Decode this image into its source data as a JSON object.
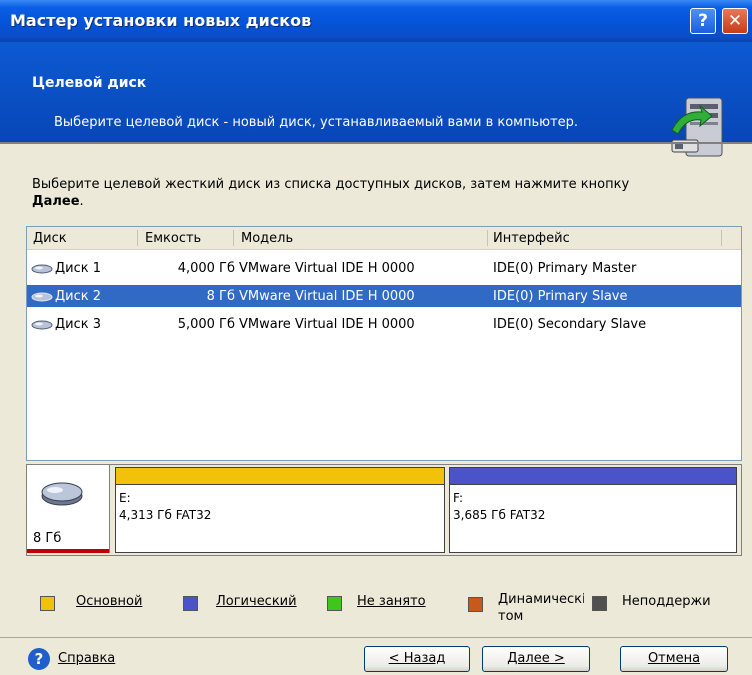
{
  "window": {
    "title": "Мастер установки новых дисков",
    "help_glyph": "?",
    "close_glyph": "✕"
  },
  "header": {
    "title": "Целевой диск",
    "subtitle": "Выберите целевой диск - новый диск, устанавливаемый вами в компьютер."
  },
  "instruction": {
    "text": "Выберите целевой жесткий диск из списка доступных дисков, затем нажмите кнопку",
    "bold": "Далее",
    "suffix": "."
  },
  "table": {
    "columns": [
      "Диск",
      "Емкость",
      "Модель",
      "Интерфейс"
    ],
    "rows": [
      {
        "disk": "Диск 1",
        "capacity": "4,000 Гб",
        "model": "VMware Virtual IDE H 0000",
        "interface": "IDE(0) Primary Master",
        "selected": false
      },
      {
        "disk": "Диск 2",
        "capacity": "8 Гб",
        "model": "VMware Virtual IDE H 0000",
        "interface": "IDE(0) Primary Slave",
        "selected": true
      },
      {
        "disk": "Диск 3",
        "capacity": "5,000 Гб",
        "model": "VMware Virtual IDE H 0000",
        "interface": "IDE(0) Secondary Slave",
        "selected": false
      }
    ]
  },
  "disk_map": {
    "size": "8 Гб",
    "partitions": [
      {
        "letter": "E:",
        "info": "4,313 Гб  FAT32",
        "color": "#f2c20a"
      },
      {
        "letter": "F:",
        "info": "3,685 Гб  FAT32",
        "color": "#4a54c8"
      }
    ]
  },
  "legend": [
    {
      "label": "Основной",
      "color": "#f2c20a"
    },
    {
      "label": "Логический",
      "color": "#4a54c8"
    },
    {
      "label": "Не занято",
      "color": "#3fc61c"
    },
    {
      "label": "Динамическі том",
      "color": "#c8581c"
    },
    {
      "label": "Неподдержи",
      "color": "#505050"
    }
  ],
  "footer": {
    "help": "Справка",
    "back": "< Назад",
    "next": "Далее >",
    "cancel": "Отмена"
  },
  "colors": {
    "titlebar": "#0552d6",
    "header": "#0b54c8",
    "selection": "#316ac5"
  }
}
